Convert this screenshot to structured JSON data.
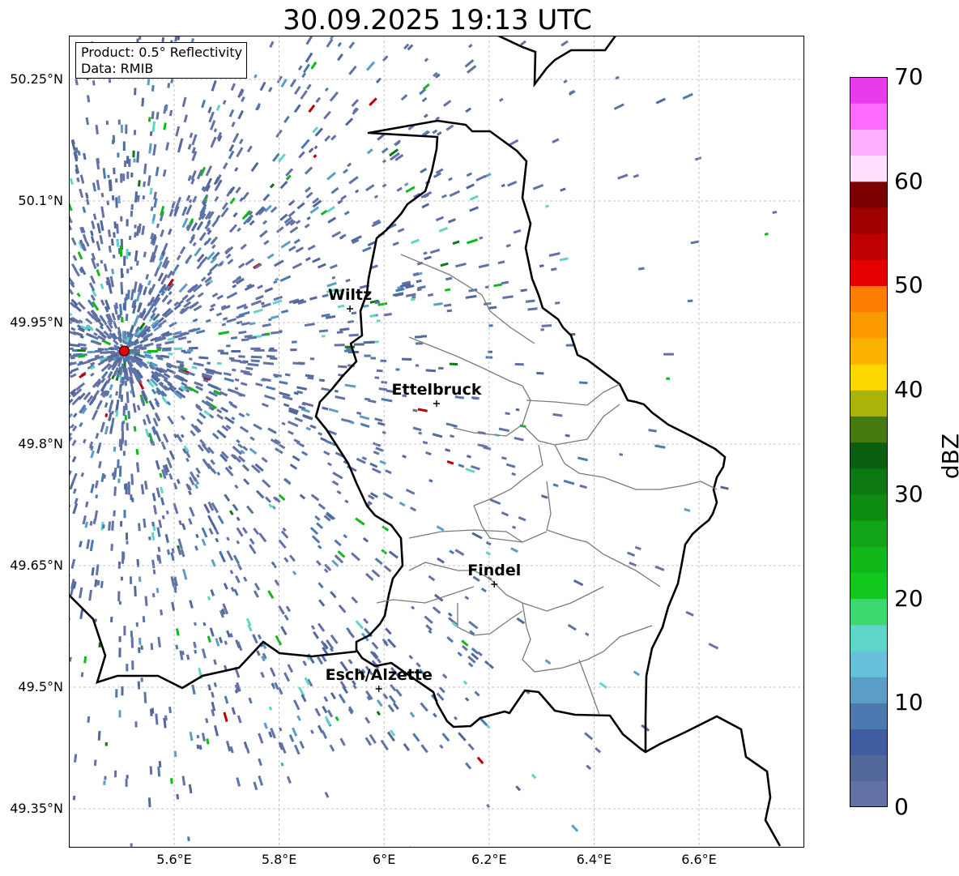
{
  "title": "30.09.2025 19:13 UTC",
  "info": {
    "product": "Product: 0.5° Reflectivity",
    "data": "Data: RMIB"
  },
  "map": {
    "lon_range": [
      5.4,
      6.8
    ],
    "lat_range": [
      49.28,
      50.28
    ],
    "lat_ticks": [
      {
        "value": 50.25,
        "label": "50.25°N"
      },
      {
        "value": 50.1,
        "label": "50.1°N"
      },
      {
        "value": 49.95,
        "label": "49.95°N"
      },
      {
        "value": 49.8,
        "label": "49.8°N"
      },
      {
        "value": 49.65,
        "label": "49.65°N"
      },
      {
        "value": 49.5,
        "label": "49.5°N"
      },
      {
        "value": 49.35,
        "label": "49.35°N"
      }
    ],
    "lon_ticks": [
      {
        "value": 5.6,
        "label": "5.6°E"
      },
      {
        "value": 5.8,
        "label": "5.8°E"
      },
      {
        "value": 6.0,
        "label": "6°E"
      },
      {
        "value": 6.2,
        "label": "6.2°E"
      },
      {
        "value": 6.4,
        "label": "6.4°E"
      },
      {
        "value": 6.6,
        "label": "6.6°E"
      }
    ],
    "grid": true,
    "radar_site": {
      "lon": 5.505,
      "lat": 49.915
    },
    "cities": [
      {
        "name": "Wiltz",
        "lon": 5.935,
        "lat": 49.967
      },
      {
        "name": "Ettelbruck",
        "lon": 6.1,
        "lat": 49.85
      },
      {
        "name": "Findel",
        "lon": 6.21,
        "lat": 49.627
      },
      {
        "name": "Esch/Alzette",
        "lon": 5.99,
        "lat": 49.498
      }
    ]
  },
  "colorbar": {
    "label": "dBZ",
    "min": 0,
    "max": 70,
    "ticks": [
      {
        "value": 70,
        "label": "70"
      },
      {
        "value": 60,
        "label": "60"
      },
      {
        "value": 50,
        "label": "50"
      },
      {
        "value": 40,
        "label": "40"
      },
      {
        "value": 30,
        "label": "30"
      },
      {
        "value": 20,
        "label": "20"
      },
      {
        "value": 10,
        "label": "10"
      },
      {
        "value": 0,
        "label": "0"
      }
    ],
    "colors": [
      "#6272a6",
      "#52689c",
      "#415da2",
      "#4a7ab0",
      "#5a9ec8",
      "#67c0dc",
      "#5ed6c8",
      "#3ed870",
      "#12c81c",
      "#12b81a",
      "#12a418",
      "#0e8c12",
      "#0c7810",
      "#0a6010",
      "#467a10",
      "#aab408",
      "#fcd800",
      "#fcb200",
      "#fc9a00",
      "#fc7e00",
      "#e40000",
      "#be0000",
      "#a00000",
      "#7a0000",
      "#ffe0ff",
      "#ffb0ff",
      "#ff6cff",
      "#e83cec"
    ]
  }
}
